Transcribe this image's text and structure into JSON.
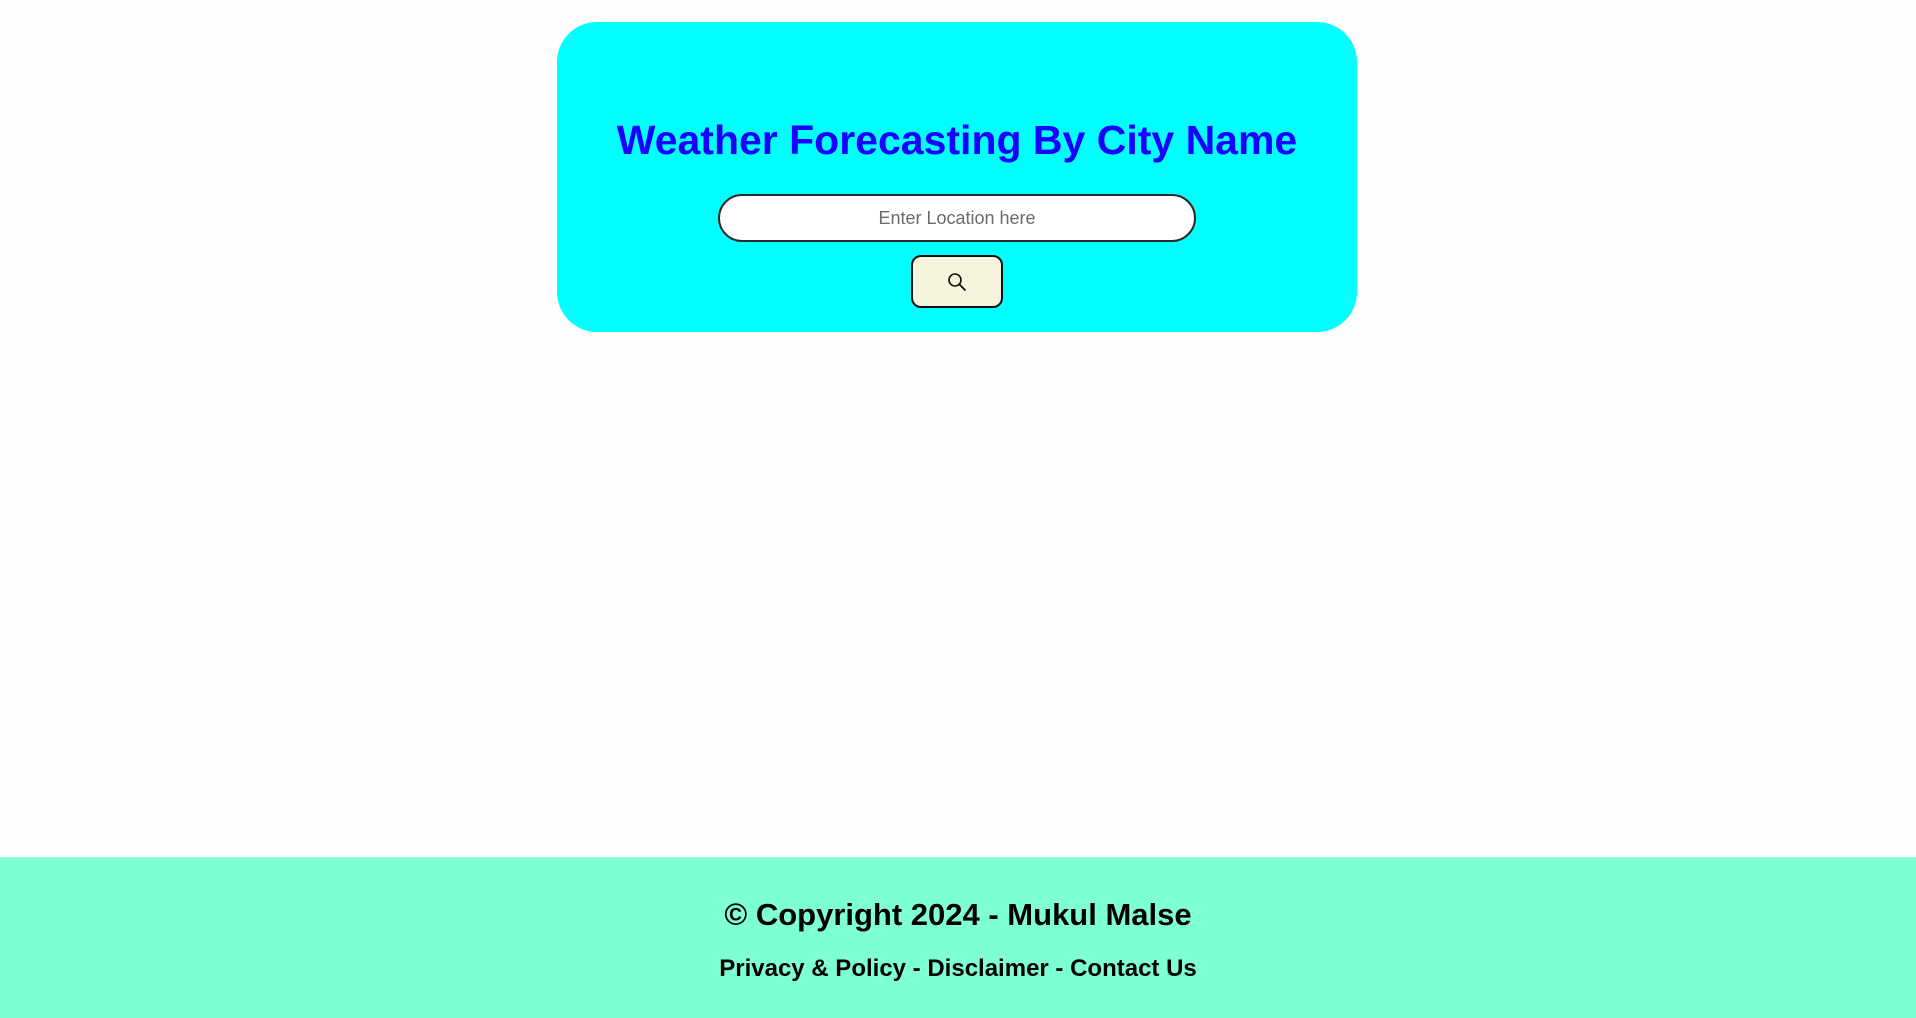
{
  "weather": {
    "title": "Weather Forecasting By City Name",
    "search_input": {
      "placeholder": "Enter Location here",
      "value": ""
    },
    "search_button_icon": "search-icon"
  },
  "footer": {
    "copyright": "© Copyright 2024 - Mukul Malse",
    "links": [
      "Privacy & Policy",
      "Disclaimer",
      "Contact Us"
    ],
    "separator": " - "
  },
  "colors": {
    "card_background": "#00ffff",
    "title": "#1a00ff",
    "footer_background": "#7fffd4",
    "search_button_background": "#f5f4dd"
  }
}
